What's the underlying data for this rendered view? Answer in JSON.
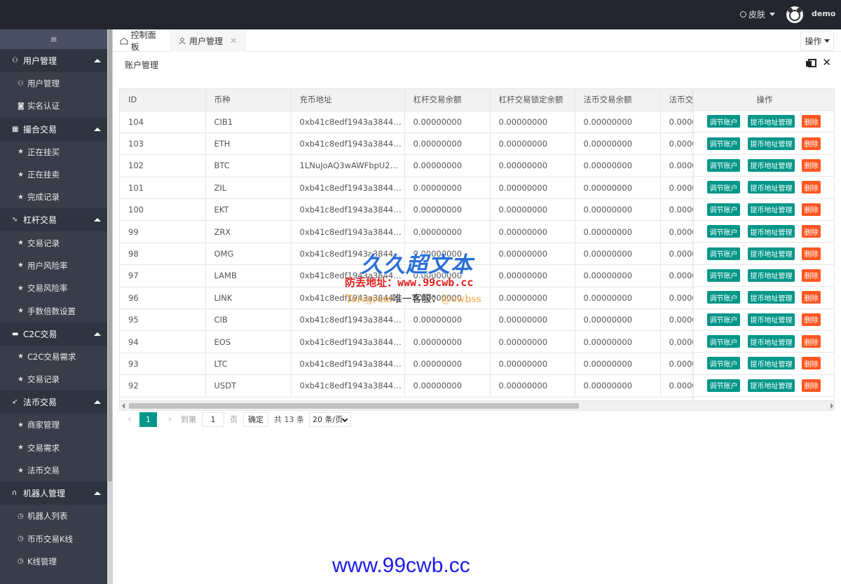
{
  "header": {
    "skin_label": "皮肤",
    "username": "demo"
  },
  "sidebar": {
    "toggle_icon": "≡",
    "groups": [
      {
        "label": "用户管理",
        "icon": "user-icon",
        "items": [
          {
            "label": "用户管理",
            "icon": "user-icon"
          },
          {
            "label": "实名认证",
            "icon": "camera-icon"
          }
        ]
      },
      {
        "label": "撮合交易",
        "icon": "grid-icon",
        "items": [
          {
            "label": "正在挂买",
            "icon": "star-icon"
          },
          {
            "label": "正在挂卖",
            "icon": "star-icon"
          },
          {
            "label": "完成记录",
            "icon": "star-icon"
          }
        ]
      },
      {
        "label": "杠杆交易",
        "icon": "pulse-icon",
        "items": [
          {
            "label": "交易记录",
            "icon": "star-icon"
          },
          {
            "label": "用户风险率",
            "icon": "star-icon"
          },
          {
            "label": "交易风险率",
            "icon": "star-icon"
          },
          {
            "label": "手数倍数设置",
            "icon": "star-icon"
          }
        ]
      },
      {
        "label": "C2C交易",
        "icon": "chat-icon",
        "items": [
          {
            "label": "C2C交易需求",
            "icon": "star-icon"
          },
          {
            "label": "交易记录",
            "icon": "star-icon"
          }
        ]
      },
      {
        "label": "法币交易",
        "icon": "rocket-icon",
        "items": [
          {
            "label": "商家管理",
            "icon": "star-icon"
          },
          {
            "label": "交易需求",
            "icon": "star-icon"
          },
          {
            "label": "法币交易",
            "icon": "star-icon"
          }
        ]
      },
      {
        "label": "机器人管理",
        "icon": "headset-icon",
        "items": [
          {
            "label": "机器人列表",
            "icon": "clock-icon"
          },
          {
            "label": "币币交易K线",
            "icon": "clock-icon"
          },
          {
            "label": "K线管理",
            "icon": "clock-icon"
          }
        ]
      }
    ]
  },
  "tabs": [
    {
      "label": "控制面板",
      "icon": "home-icon"
    },
    {
      "label": "用户管理",
      "icon": "user-icon",
      "closable": true
    }
  ],
  "ops_label": "操作",
  "panel": {
    "title": "账户管理"
  },
  "table": {
    "columns": [
      "ID",
      "币种",
      "充币地址",
      "杠杆交易余额",
      "杠杆交易锁定余额",
      "法币交易余额",
      "法币交"
    ],
    "actions_header": "操作",
    "action_labels": {
      "adjust": "调节账户",
      "address": "提币地址管理",
      "delete": "删除"
    },
    "rows": [
      [
        "104",
        "CIB1",
        "0xb41c8edf1943a38445…",
        "0.00000000",
        "0.00000000",
        "0.00000000",
        "0.0000"
      ],
      [
        "103",
        "ETH",
        "0xb41c8edf1943a38445…",
        "0.00000000",
        "0.00000000",
        "0.00000000",
        "0.0000"
      ],
      [
        "102",
        "BTC",
        "1LNuJoAQ3wAWFbpU2…",
        "0.00000000",
        "0.00000000",
        "0.00000000",
        "0.0000"
      ],
      [
        "101",
        "ZIL",
        "0xb41c8edf1943a38445…",
        "0.00000000",
        "0.00000000",
        "0.00000000",
        "0.0000"
      ],
      [
        "100",
        "EKT",
        "0xb41c8edf1943a38445…",
        "0.00000000",
        "0.00000000",
        "0.00000000",
        "0.0000"
      ],
      [
        "99",
        "ZRX",
        "0xb41c8edf1943a38445…",
        "0.00000000",
        "0.00000000",
        "0.00000000",
        "0.0000"
      ],
      [
        "98",
        "OMG",
        "0xb41c8edf1943a38445…",
        "0.00000000",
        "0.00000000",
        "0.00000000",
        "0.0000"
      ],
      [
        "97",
        "LAMB",
        "0xb41c8edf1943a38445…",
        "0.00000000",
        "0.00000000",
        "0.00000000",
        "0.0000"
      ],
      [
        "96",
        "LINK",
        "0xb41c8edf1943a38445…",
        "0.00000000",
        "0.00000000",
        "0.00000000",
        "0.0000"
      ],
      [
        "95",
        "CIB",
        "0xb41c8edf1943a38445…",
        "0.00000000",
        "0.00000000",
        "0.00000000",
        "0.0000"
      ],
      [
        "94",
        "EOS",
        "0xb41c8edf1943a38445…",
        "0.00000000",
        "0.00000000",
        "0.00000000",
        "0.0000"
      ],
      [
        "93",
        "LTC",
        "0xb41c8edf1943a38445…",
        "0.00000000",
        "0.00000000",
        "0.00000000",
        "0.0000"
      ],
      [
        "92",
        "USDT",
        "0xb41c8edf1943a38445…",
        "0.00000000",
        "0.00000000",
        "0.00000000",
        "0.0000"
      ]
    ]
  },
  "pagination": {
    "current_page": "1",
    "goto_label": "到第",
    "page_input": "1",
    "page_unit": "页",
    "confirm_label": "确定",
    "total_label": "共 13 条",
    "page_size": "20 条/页"
  },
  "watermark": {
    "title": "久久超文本",
    "address": "防丢地址：www.99cwb.cc",
    "telegram_prefix": "Telegram",
    "telegram_mid": "唯一客服：",
    "telegram_handle": "@cwbss",
    "bottom_url": "www.99cwb.cc"
  },
  "colors": {
    "header_bg": "#23262e",
    "sidebar_bg": "#393d49",
    "accent": "#009688",
    "danger": "#ff5722"
  }
}
